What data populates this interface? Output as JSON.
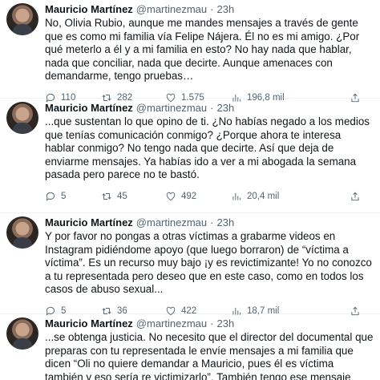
{
  "tweets": [
    {
      "name": "Mauricio Martínez",
      "handle": "@martinezmau",
      "dot": "·",
      "time": "23h",
      "text": "No, Olivia Rubio, aunque me mandes mensajes a través de gente que es como mi familia vía Felipe Nájera. Él no es mi amigo. ¿Por qué meterlo a él y a mi familia en esto? No hay nada que hablar, nada que conciliar, nada que decirte. Aunque amenaces con demandarme, tengo pruebas…",
      "replies": "110",
      "retweets": "282",
      "likes": "1.575",
      "views": "196,8 mil"
    },
    {
      "name": "Mauricio Martínez",
      "handle": "@martinezmau",
      "dot": "·",
      "time": "23h",
      "text": "...que sustentan lo que opino de ti. ¿No habías negado a los medios que tenías comunicación conmigo? ¿Porque ahora te interesa hablar conmigo? No tengo nada que decirte. Así que deja de enviarme mensajes. Ya habías ido a ver a mi abogada la semana pasada pero parece no te bastó.",
      "replies": "5",
      "retweets": "45",
      "likes": "492",
      "views": "20,4 mil"
    },
    {
      "name": "Mauricio Martínez",
      "handle": "@martinezmau",
      "dot": "·",
      "time": "23h",
      "text": "Y por favor no pongas a otras víctimas a grabarme videos en Instagram pidiéndome apoyo (que luego borraron) de “víctima a víctima”. Es un recurso muy bajo ¡y es revictimizante! Yo no conozco a tu representada pero deseo que en este caso, como en todos los casos de abuso sexual...",
      "replies": "5",
      "retweets": "36",
      "likes": "422",
      "views": "18,7 mil"
    },
    {
      "name": "Mauricio Martínez",
      "handle": "@martinezmau",
      "dot": "·",
      "time": "23h",
      "text": "...se obtenga justicia. No necesito que el director del documental que preparas con tu representada le envíe mensajes a mi familia que dicen “Oli no quiere demandar a Mauricio, pues él es víctima también y eso sería re victimizarlo”. También tengo ese mensaje grabado, por cierto."
    }
  ]
}
